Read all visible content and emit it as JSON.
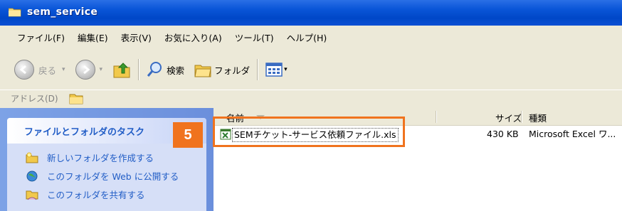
{
  "window": {
    "title": "sem_service"
  },
  "menu": [
    "ファイル(F)",
    "編集(E)",
    "表示(V)",
    "お気に入り(A)",
    "ツール(T)",
    "ヘルプ(H)"
  ],
  "toolbar": {
    "back_label": "戻る",
    "search_label": "検索",
    "folders_label": "フォルダ"
  },
  "address": {
    "label": "アドレス(D)"
  },
  "tasks": {
    "title": "ファイルとフォルダのタスク",
    "items": [
      "新しいフォルダを作成する",
      "このフォルダを Web に公開する",
      "このフォルダを共有する"
    ]
  },
  "columns": {
    "name": "名前",
    "size": "サイズ",
    "type": "種類"
  },
  "files": [
    {
      "name": "SEMチケット-サービス依頼ファイル.xls",
      "size": "430 KB",
      "type": "Microsoft Excel ワ..."
    }
  ],
  "callout": {
    "number": "5",
    "color": "#f0731e"
  }
}
